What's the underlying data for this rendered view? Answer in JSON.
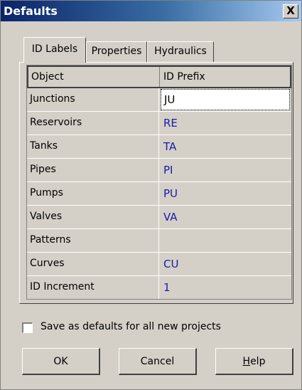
{
  "window": {
    "title": "Defaults",
    "close_label": "X"
  },
  "tabs": [
    {
      "label": "ID Labels",
      "active": true
    },
    {
      "label": "Properties",
      "active": false
    },
    {
      "label": "Hydraulics",
      "active": false
    }
  ],
  "grid": {
    "columns": [
      "Object",
      "ID Prefix"
    ],
    "rows": [
      {
        "object": "Junctions",
        "prefix": "JU"
      },
      {
        "object": "Reservoirs",
        "prefix": "RE"
      },
      {
        "object": "Tanks",
        "prefix": "TA"
      },
      {
        "object": "Pipes",
        "prefix": "PI"
      },
      {
        "object": "Pumps",
        "prefix": "PU"
      },
      {
        "object": "Valves",
        "prefix": "VA"
      },
      {
        "object": "Patterns",
        "prefix": ""
      },
      {
        "object": "Curves",
        "prefix": "CU"
      },
      {
        "object": "ID Increment",
        "prefix": "1"
      }
    ]
  },
  "save_defaults": {
    "label": "Save as defaults for all new projects",
    "checked": false
  },
  "buttons": {
    "ok": "OK",
    "cancel": "Cancel",
    "help_first": "H",
    "help_rest": "elp"
  },
  "colors": {
    "title_bar_start": "#0a246a",
    "title_bar_end": "#a6caf0",
    "prefix_text": "#1a1aa6",
    "dialog_bg": "#d4d0c8"
  }
}
